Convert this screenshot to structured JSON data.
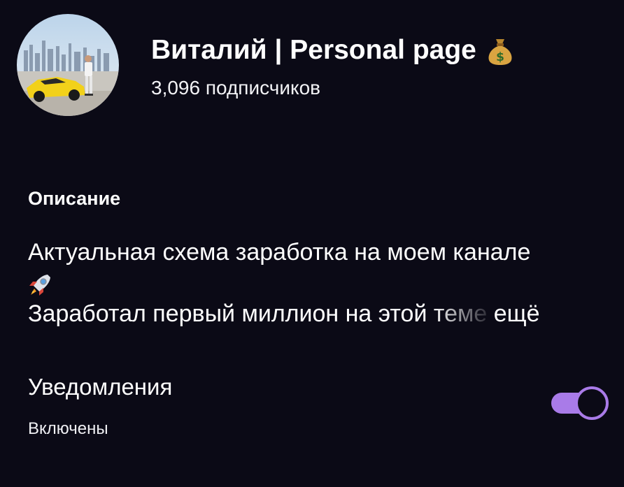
{
  "channel": {
    "title": "Виталий | Personal page",
    "title_icon": "money-bag-icon",
    "subscribers": "3,096 подписчиков",
    "avatar": "avatar-photo"
  },
  "description": {
    "label": "Описание",
    "line1": "Актуальная схема заработка на моем канале",
    "line1_icon": "rocket-icon",
    "line2_main": "Заработал первый миллион на этой ",
    "line2_faded": "теме",
    "line2_end": " ещё"
  },
  "notifications": {
    "label": "Уведомления",
    "status": "Включены",
    "enabled": true
  },
  "colors": {
    "background": "#0b0a16",
    "accent": "#a97be8",
    "text": "#ffffff"
  }
}
